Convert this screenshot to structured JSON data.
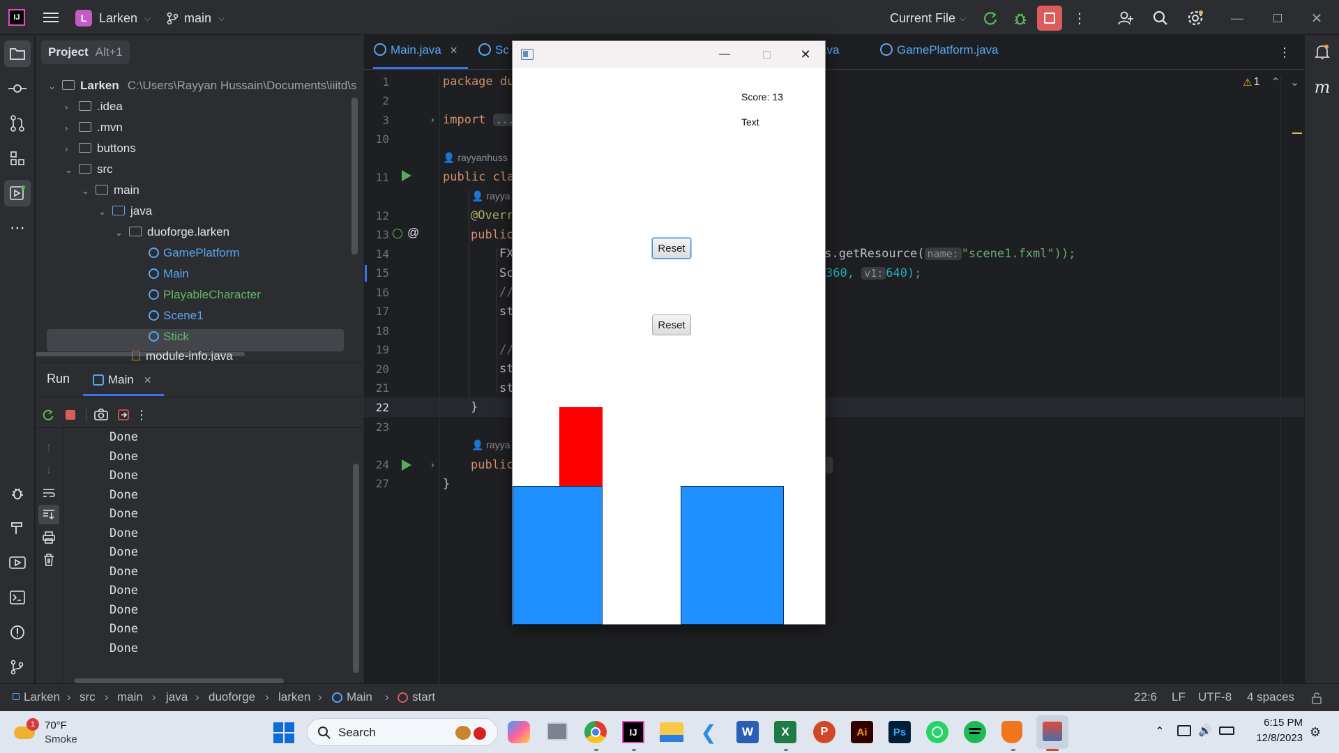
{
  "ide": {
    "project_name": "Larken",
    "project_initial": "L",
    "branch": "main",
    "run_config": "Current File",
    "project_tool": "Project",
    "project_shortcut": "Alt+1",
    "project_path": "C:\\Users\\Rayyan Hussain\\Documents\\iiitd\\s",
    "tree": [
      {
        "label": "Larken",
        "kind": "root"
      },
      {
        "label": ".idea",
        "kind": "folder"
      },
      {
        "label": ".mvn",
        "kind": "folder"
      },
      {
        "label": "buttons",
        "kind": "folder"
      },
      {
        "label": "src",
        "kind": "folder"
      },
      {
        "label": "main",
        "kind": "folder"
      },
      {
        "label": "java",
        "kind": "folder"
      },
      {
        "label": "duoforge.larken",
        "kind": "package"
      },
      {
        "label": "GamePlatform",
        "kind": "class"
      },
      {
        "label": "Main",
        "kind": "class"
      },
      {
        "label": "PlayableCharacter",
        "kind": "class"
      },
      {
        "label": "Scene1",
        "kind": "class"
      },
      {
        "label": "Stick",
        "kind": "class"
      },
      {
        "label": "module-info.java",
        "kind": "file"
      }
    ],
    "run_tab": "Run",
    "run_config_tab": "Main",
    "console": [
      "Done",
      "Done",
      "Done",
      "Done",
      "Done",
      "Done",
      "Done",
      "Done",
      "Done",
      "Done",
      "Done",
      "Done"
    ],
    "tabs": [
      "Main.java",
      "Sc",
      "ava",
      "GamePlatform.java"
    ],
    "warning_count": "1",
    "line_numbers": [
      "1",
      "2",
      "3",
      "10",
      "11",
      "12",
      "13",
      "14",
      "15",
      "16",
      "17",
      "18",
      "19",
      "20",
      "21",
      "22",
      "23",
      "24",
      "27"
    ],
    "code": {
      "l1": "package du",
      "l3": "import",
      "l3_fold": "...",
      "author": "rayyanhuss",
      "l11": "public cla",
      "author2": "rayya",
      "l12": "@Overr",
      "l13": "public",
      "l14": "FX",
      "l14_tail": "ss.getResource(",
      "l14_hint": "name:",
      "l14_str": "\"scene1.fxml\"));",
      "l15": "Sc",
      "l15_num1": "360,",
      "l15_hint": "v1:",
      "l15_num2": "640);",
      "l16": "//",
      "l17": "st",
      "l19": "//",
      "l20": "st",
      "l21": "st",
      "l22": "}",
      "author3": "rayya",
      "l24": "public",
      "l27": "}"
    },
    "breadcrumbs": [
      "Larken",
      "src",
      "main",
      "java",
      "duoforge",
      "larken",
      "Main",
      "start"
    ],
    "status": {
      "position": "22:6",
      "line_sep": "LF",
      "encoding": "UTF-8",
      "indent": "4 spaces"
    }
  },
  "game": {
    "score": "Score: 13",
    "text": "Text",
    "reset1": "Reset",
    "reset2": "Reset"
  },
  "taskbar": {
    "weather_temp": "70°F",
    "weather_desc": "Smoke",
    "weather_badge": "1",
    "search": "Search",
    "time": "6:15 PM",
    "date": "12/8/2023"
  }
}
